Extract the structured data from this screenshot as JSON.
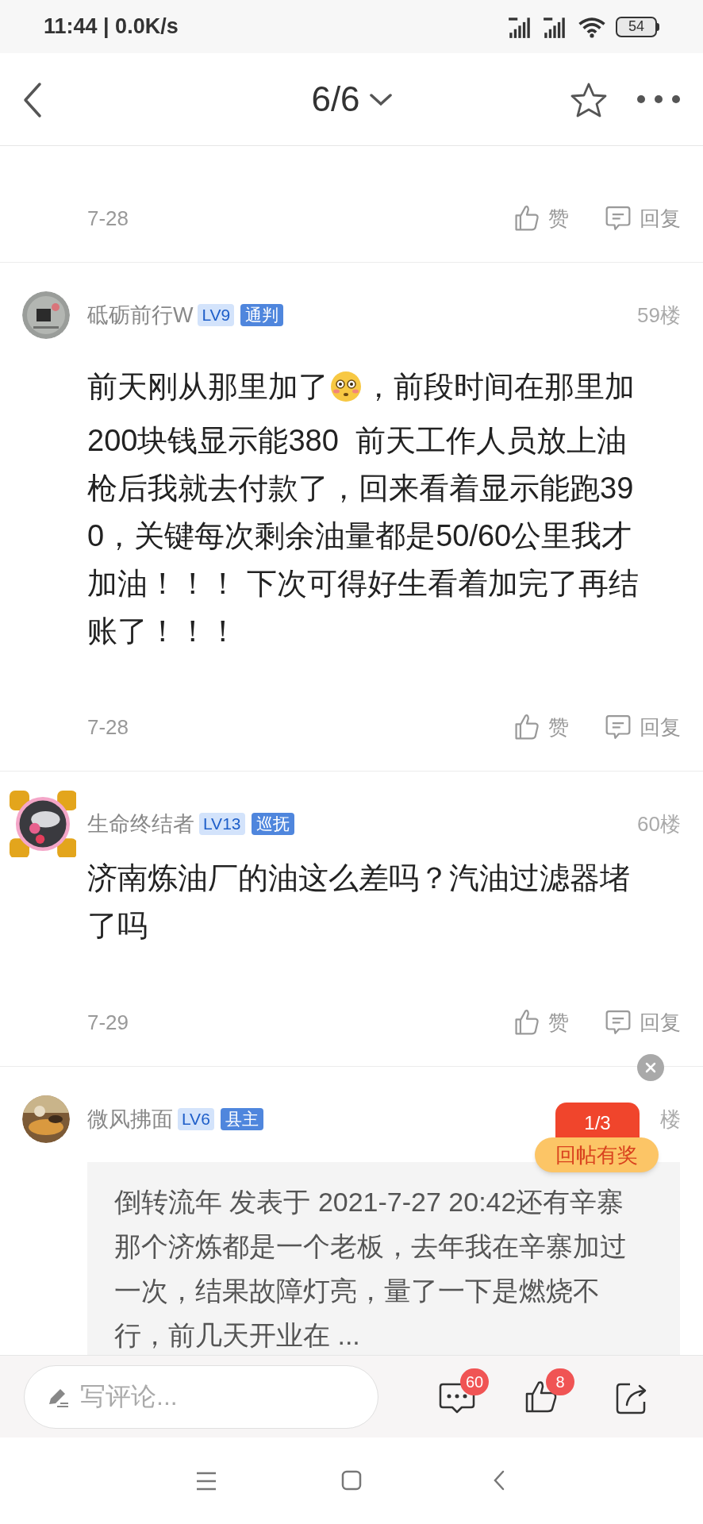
{
  "status_bar": {
    "time": "11:44 | 0.0K/s",
    "battery": "54"
  },
  "header": {
    "title": "6/6"
  },
  "comments": [
    {
      "date": "7-28",
      "like": "赞",
      "reply": "回复"
    },
    {
      "author": "砥砺前行W",
      "level": "LV9",
      "rank": "通判",
      "floor": "59楼",
      "body": [
        [
          {
            "kind": "text",
            "text": "前天刚从那里加了"
          },
          {
            "kind": "emoji"
          },
          {
            "kind": "text",
            "text": "，前段时间在那里加"
          }
        ],
        [
          {
            "kind": "text",
            "text": "200块钱显示能380  前天工作人员放上油枪后我就去付款了，回来看着显示能跑390，关键每次剩余油量都是50/60公里我才加油！！！ 下次可得好生看着加完了再结账了！！！"
          }
        ]
      ],
      "date": "7-28",
      "like": "赞",
      "reply": "回复"
    },
    {
      "author": "生命终结者",
      "level": "LV13",
      "rank": "巡抚",
      "floor": "60楼",
      "body": [
        [
          {
            "kind": "text",
            "text": "济南炼油厂的油这么差吗？汽油过滤器堵了吗"
          }
        ]
      ],
      "date": "7-29",
      "like": "赞",
      "reply": "回复"
    },
    {
      "author": "微风拂面",
      "level": "LV6",
      "rank": "县主",
      "floor": "楼",
      "quote": "倒转流年 发表于 2021-7-27 20:42还有辛寨那个济炼都是一个老板，去年我在辛寨加过一次，结果故障灯亮，量了一下是燃烧不行，前几天开业在 ..."
    }
  ],
  "reward_widget": {
    "page": "1/3",
    "label": "回帖有奖"
  },
  "comment_bar": {
    "placeholder": "写评论...",
    "comment_count": "60",
    "like_count": "8"
  }
}
